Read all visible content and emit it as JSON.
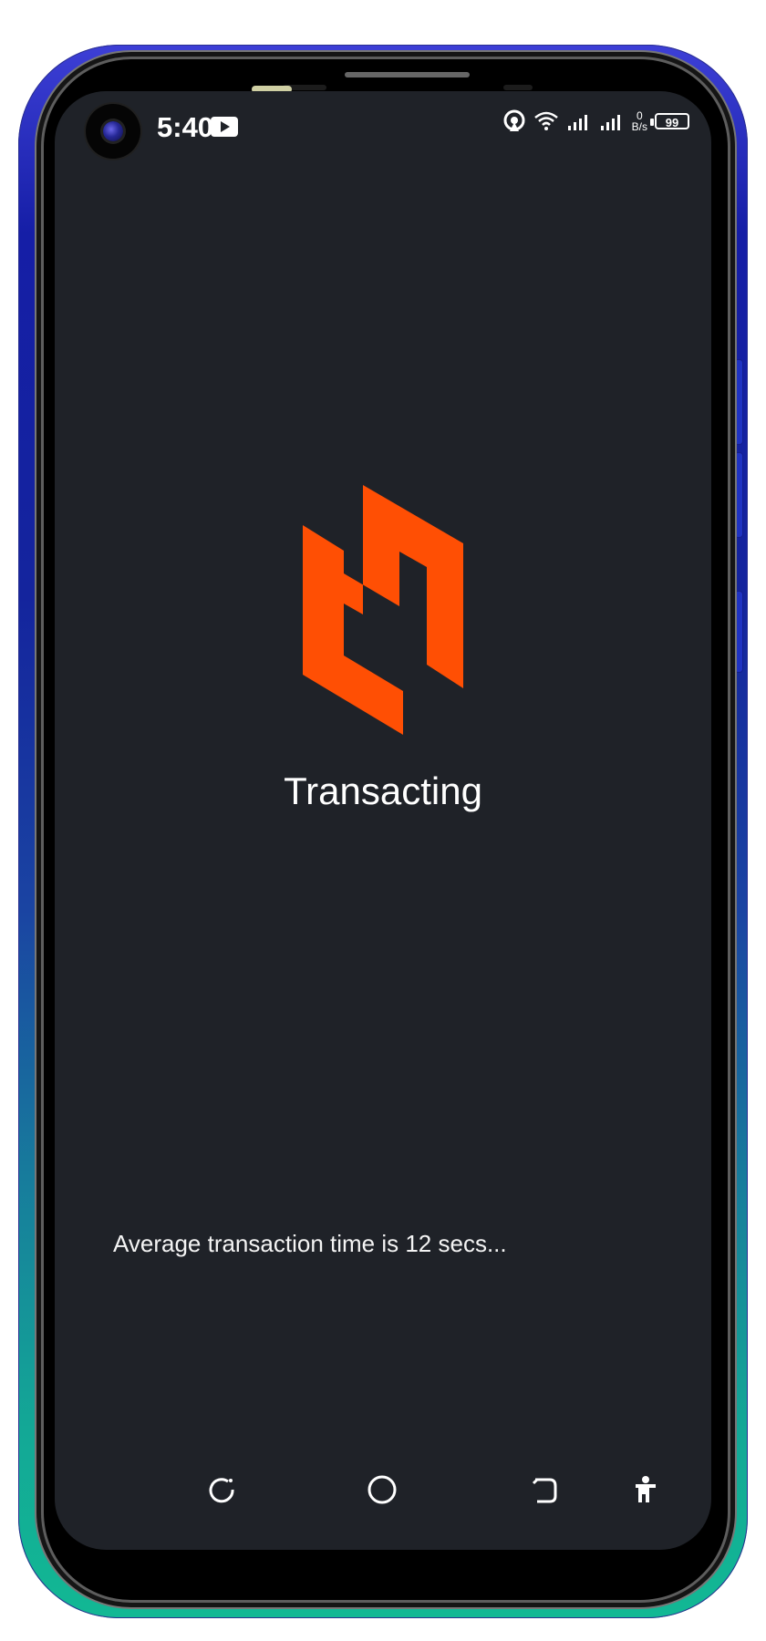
{
  "status_bar": {
    "time": "5:40",
    "network_speed_top": "0",
    "network_speed_unit": "B/s",
    "battery_level": "99"
  },
  "screen": {
    "title": "Transacting",
    "notice": "Average transaction time is 12 secs..."
  },
  "icons": {
    "brand_logo": "brand-logo",
    "recents": "recents-icon",
    "home": "home-icon",
    "back": "back-icon",
    "accessibility": "accessibility-icon"
  },
  "colors": {
    "background": "#1f2228",
    "accent": "#ff4f04"
  }
}
